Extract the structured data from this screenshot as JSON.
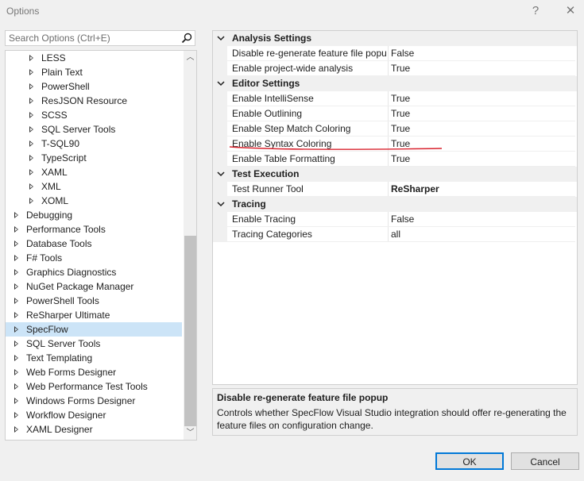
{
  "window": {
    "title": "Options",
    "help_label": "?",
    "close_label": "✕"
  },
  "search": {
    "placeholder": "Search Options (Ctrl+E)"
  },
  "tree": {
    "items": [
      {
        "label": "LESS",
        "level": 1
      },
      {
        "label": "Plain Text",
        "level": 1
      },
      {
        "label": "PowerShell",
        "level": 1
      },
      {
        "label": "ResJSON Resource",
        "level": 1
      },
      {
        "label": "SCSS",
        "level": 1
      },
      {
        "label": "SQL Server Tools",
        "level": 1
      },
      {
        "label": "T-SQL90",
        "level": 1
      },
      {
        "label": "TypeScript",
        "level": 1
      },
      {
        "label": "XAML",
        "level": 1
      },
      {
        "label": "XML",
        "level": 1
      },
      {
        "label": "XOML",
        "level": 1
      },
      {
        "label": "Debugging",
        "level": 0
      },
      {
        "label": "Performance Tools",
        "level": 0
      },
      {
        "label": "Database Tools",
        "level": 0
      },
      {
        "label": "F# Tools",
        "level": 0
      },
      {
        "label": "Graphics Diagnostics",
        "level": 0
      },
      {
        "label": "NuGet Package Manager",
        "level": 0
      },
      {
        "label": "PowerShell Tools",
        "level": 0
      },
      {
        "label": "ReSharper Ultimate",
        "level": 0
      },
      {
        "label": "SpecFlow",
        "level": 0,
        "selected": true
      },
      {
        "label": "SQL Server Tools",
        "level": 0
      },
      {
        "label": "Text Templating",
        "level": 0
      },
      {
        "label": "Web Forms Designer",
        "level": 0
      },
      {
        "label": "Web Performance Test Tools",
        "level": 0
      },
      {
        "label": "Windows Forms Designer",
        "level": 0
      },
      {
        "label": "Workflow Designer",
        "level": 0
      },
      {
        "label": "XAML Designer",
        "level": 0
      }
    ]
  },
  "properties": {
    "rows": [
      {
        "type": "category",
        "label": "Analysis Settings"
      },
      {
        "type": "property",
        "name": "Disable re-generate feature file popup",
        "value": "False"
      },
      {
        "type": "property",
        "name": "Enable project-wide analysis",
        "value": "True"
      },
      {
        "type": "category",
        "label": "Editor Settings"
      },
      {
        "type": "property",
        "name": "Enable IntelliSense",
        "value": "True"
      },
      {
        "type": "property",
        "name": "Enable Outlining",
        "value": "True"
      },
      {
        "type": "property",
        "name": "Enable Step Match Coloring",
        "value": "True"
      },
      {
        "type": "property",
        "name": "Enable Syntax Coloring",
        "value": "True",
        "underlined": true
      },
      {
        "type": "property",
        "name": "Enable Table Formatting",
        "value": "True"
      },
      {
        "type": "category",
        "label": "Test Execution"
      },
      {
        "type": "property",
        "name": "Test Runner Tool",
        "value": "ReSharper",
        "bold": true
      },
      {
        "type": "category",
        "label": "Tracing"
      },
      {
        "type": "property",
        "name": "Enable Tracing",
        "value": "False"
      },
      {
        "type": "property",
        "name": "Tracing Categories",
        "value": "all"
      }
    ]
  },
  "description": {
    "title": "Disable re-generate feature file popup",
    "text": "Controls whether SpecFlow Visual Studio integration should offer re-generating the feature files on configuration change."
  },
  "buttons": {
    "ok": "OK",
    "cancel": "Cancel"
  },
  "colors": {
    "accent": "#0078d7",
    "selection": "#cce4f7",
    "annotation": "#d9232e"
  },
  "icons": {
    "search": "search-icon",
    "expand": "triangle-right-icon",
    "collapse": "chevron-down-icon"
  }
}
